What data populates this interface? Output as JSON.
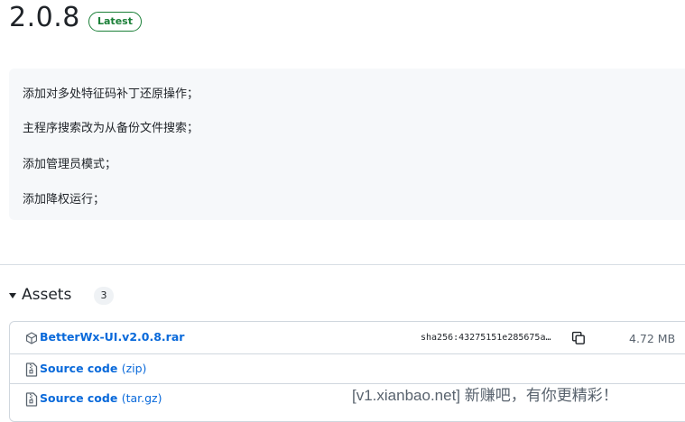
{
  "release": {
    "version": "2.0.8",
    "badge": "Latest",
    "notes": [
      "添加对多处特征码补丁还原操作；",
      "主程序搜索改为从备份文件搜索；",
      "添加管理员模式；",
      "添加降权运行；"
    ]
  },
  "assets": {
    "title": "Assets",
    "count": "3",
    "items": [
      {
        "name": "BetterWx-UI.v2.0.8.rar",
        "suffix": "",
        "sha": "sha256:43275151e285675a…",
        "size": "4.72 MB",
        "icon": "package-icon"
      },
      {
        "name": "Source code",
        "suffix": "(zip)",
        "icon": "file-zip-icon"
      },
      {
        "name": "Source code",
        "suffix": "(tar.gz)",
        "icon": "file-zip-icon"
      }
    ]
  },
  "watermark": "[v1.xianbao.net] 新赚吧，有你更精彩！",
  "colors": {
    "accent": "#0969da",
    "badge": "#1a7f37",
    "notes_bg": "#f6f8fa"
  }
}
